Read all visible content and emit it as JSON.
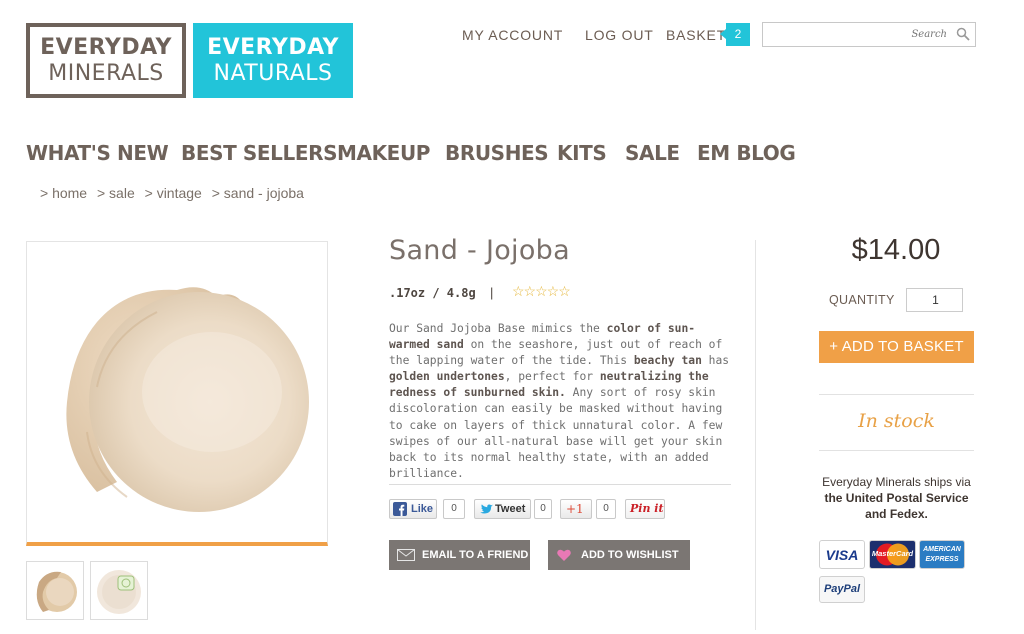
{
  "logos": {
    "everyday_minerals": {
      "line1": "EVERYDAY",
      "line2": "MINERALS"
    },
    "everyday_naturals": {
      "line1": "EVERYDAY",
      "line2": "NATURALS"
    }
  },
  "header": {
    "my_account": "MY ACCOUNT",
    "log_out": "LOG OUT",
    "basket": "BASKET",
    "basket_count": "2",
    "search_placeholder": "Search"
  },
  "nav": {
    "items": [
      "WHAT'S NEW",
      "BEST SELLERS",
      "MAKEUP",
      "BRUSHES",
      "KITS",
      "SALE",
      "EM BLOG"
    ]
  },
  "breadcrumb": [
    "> home",
    "> sale",
    "> vintage",
    "> sand - jojoba"
  ],
  "product": {
    "title": "Sand - Jojoba",
    "size": ".17oz / 4.8g",
    "separator": "|",
    "rating": 0,
    "rating_stars": "☆☆☆☆☆",
    "description": [
      {
        "t": "Our Sand Jojoba Base mimics the ",
        "b": false
      },
      {
        "t": "color of sun-warmed sand",
        "b": true
      },
      {
        "t": " on the seashore, just out of reach of the lapping water of the tide. This ",
        "b": false
      },
      {
        "t": "beachy tan",
        "b": true
      },
      {
        "t": " has ",
        "b": false
      },
      {
        "t": "golden undertones",
        "b": true
      },
      {
        "t": ", perfect for ",
        "b": false
      },
      {
        "t": "neutralizing the redness of sunburned skin.",
        "b": true
      },
      {
        "t": " Any sort of rosy skin discoloration can easily be masked without having to cake on layers of thick unnatural color. A few swipes of our all-natural base will get your skin back to its normal healthy state, with an added brilliance.",
        "b": false
      }
    ],
    "price": "$14.00",
    "quantity_label": "QUANTITY",
    "quantity_value": "1",
    "add_to_basket": "+ ADD TO BASKET",
    "stock_status": "In stock",
    "shipping_line1": "Everyday Minerals ships via",
    "shipping_line2": "the United Postal Service",
    "shipping_line3": "and Fedex."
  },
  "social": {
    "like_label": "Like",
    "like_count": "0",
    "tweet_label": "Tweet",
    "tweet_count": "0",
    "gplus_label": "+1",
    "gplus_count": "0",
    "pinit_label": "Pin it"
  },
  "actions": {
    "email_friend": "EMAIL TO A FRIEND",
    "add_wishlist": "ADD TO WISHLIST"
  },
  "payment": {
    "visa": "VISA",
    "mastercard": "MasterCard",
    "amex_line1": "AMERICAN",
    "amex_line2": "EXPRESS",
    "paypal": "PayPal"
  },
  "colors": {
    "accent_teal": "#22c4d9",
    "accent_orange": "#f0a047",
    "brand_brown": "#6e625a",
    "button_gray": "#7b7673"
  },
  "icons": [
    "search-icon",
    "envelope-icon",
    "heart-icon",
    "facebook-icon",
    "twitter-icon",
    "star-icon"
  ]
}
